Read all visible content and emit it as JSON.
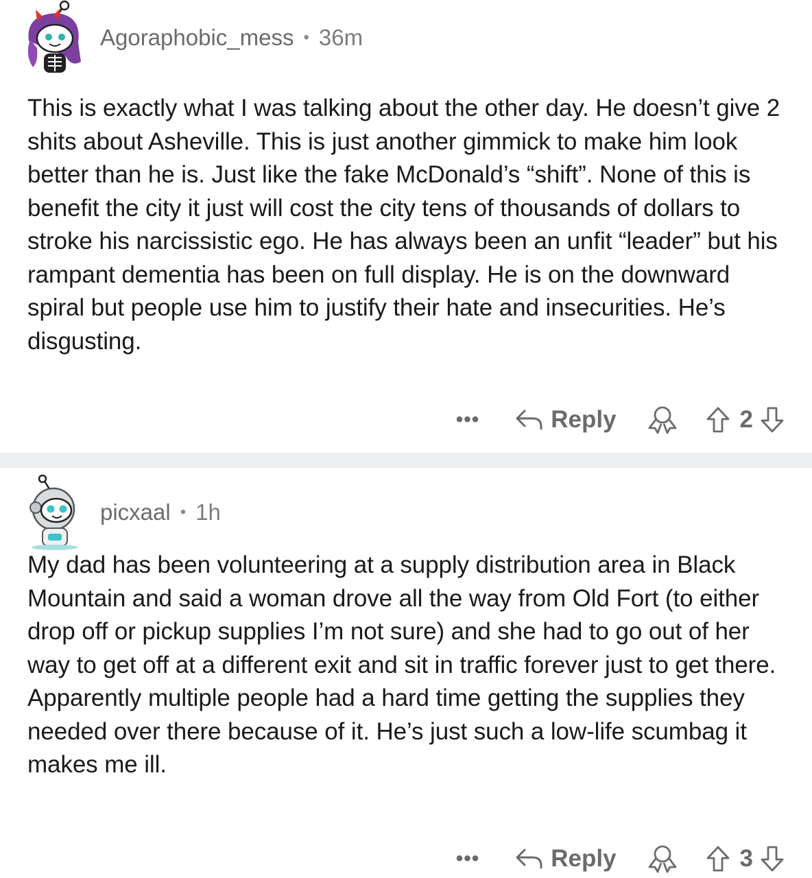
{
  "comments": [
    {
      "username": "Agoraphobic_mess",
      "separator": "•",
      "age": "36m",
      "body": "This is exactly what I was talking about the other day. He doesn’t give 2 shits about Asheville. This is just another gimmick to make him look better than he is. Just like the fake McDonald’s “shift”. None of this is benefit the city it just will cost the city tens of thousands of dollars to stroke his narcissistic ego. He has always been an unfit “leader” but his rampant dementia has been on full display. He is on the downward spiral but people use him to justify their hate and insecurities. He’s disgusting.",
      "more_label": "•••",
      "reply_label": "Reply",
      "score": "2",
      "avatar_icon": "snoo-avatar-purple-hair",
      "accent": "#7b3fa0"
    },
    {
      "username": "picxaal",
      "separator": "•",
      "age": "1h",
      "body": "My dad has been volunteering at a supply distribution area in Black Mountain and said a woman drove all the way from Old Fort (to either drop off or pickup supplies I’m not sure) and she had to go out of her way to get off at a different exit and sit in traffic forever just to get there. Apparently multiple people had a hard time getting the supplies they needed over there because of it. He’s just such a low-life scumbag it makes me ill.",
      "more_label": "•••",
      "reply_label": "Reply",
      "score": "3",
      "avatar_icon": "snoo-avatar-astronaut",
      "accent": "#3cc4c4"
    }
  ],
  "colors": {
    "text": "#1a1a1b",
    "meta": "#7c7c7c",
    "divider": "#eceef0"
  }
}
